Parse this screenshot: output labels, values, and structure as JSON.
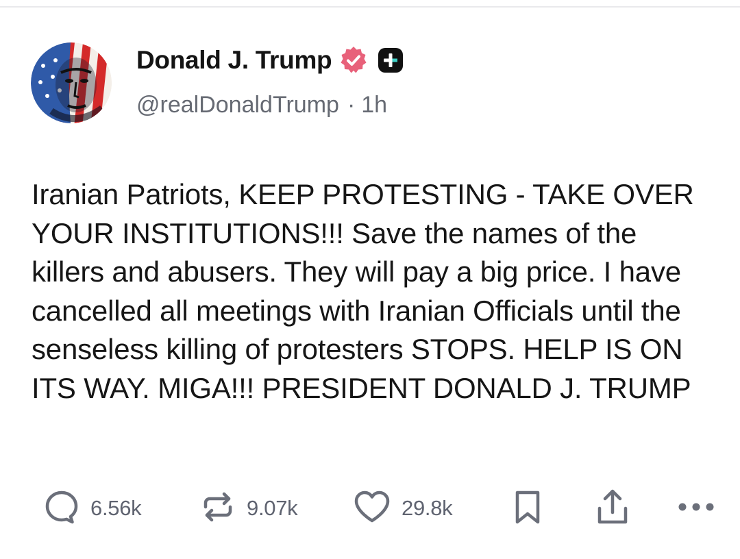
{
  "post": {
    "author": {
      "display_name": "Donald J. Trump",
      "handle": "@realDonaldTrump",
      "separator": "·",
      "time": "1h",
      "verified_badge_color": "#e8617a"
    },
    "text": "Iranian Patriots, KEEP PROTESTING - TAKE OVER YOUR INSTITUTIONS!!! Save the names of the killers and abusers. They will pay a big price. I have cancelled all meetings with Iranian Officials until the senseless killing of protesters STOPS. HELP IS ON ITS WAY. MIGA!!! PRESIDENT DONALD J. TRUMP",
    "actions": {
      "reply_count": "6.56k",
      "repost_count": "9.07k",
      "like_count": "29.8k"
    }
  },
  "icons": {
    "verified": "verified-badge-icon",
    "plus": "plus-icon",
    "reply": "reply-icon",
    "repost": "repost-icon",
    "like": "heart-icon",
    "bookmark": "bookmark-icon",
    "share": "share-icon",
    "more": "more-icon"
  }
}
